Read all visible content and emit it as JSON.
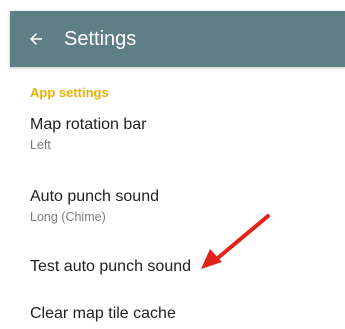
{
  "app_bar": {
    "title": "Settings",
    "back_icon": "arrow-back-icon",
    "background": "#5f7f86"
  },
  "section": {
    "header": "App settings",
    "header_color": "#e8b100"
  },
  "preferences": [
    {
      "title": "Map rotation bar",
      "summary": "Left"
    },
    {
      "title": "Auto punch sound",
      "summary": "Long (Chime)"
    },
    {
      "title": "Test auto punch sound",
      "summary": ""
    },
    {
      "title": "Clear map tile cache",
      "summary": ""
    }
  ],
  "annotation": {
    "icon": "red-arrow-pointer-icon",
    "color": "#e32219"
  }
}
